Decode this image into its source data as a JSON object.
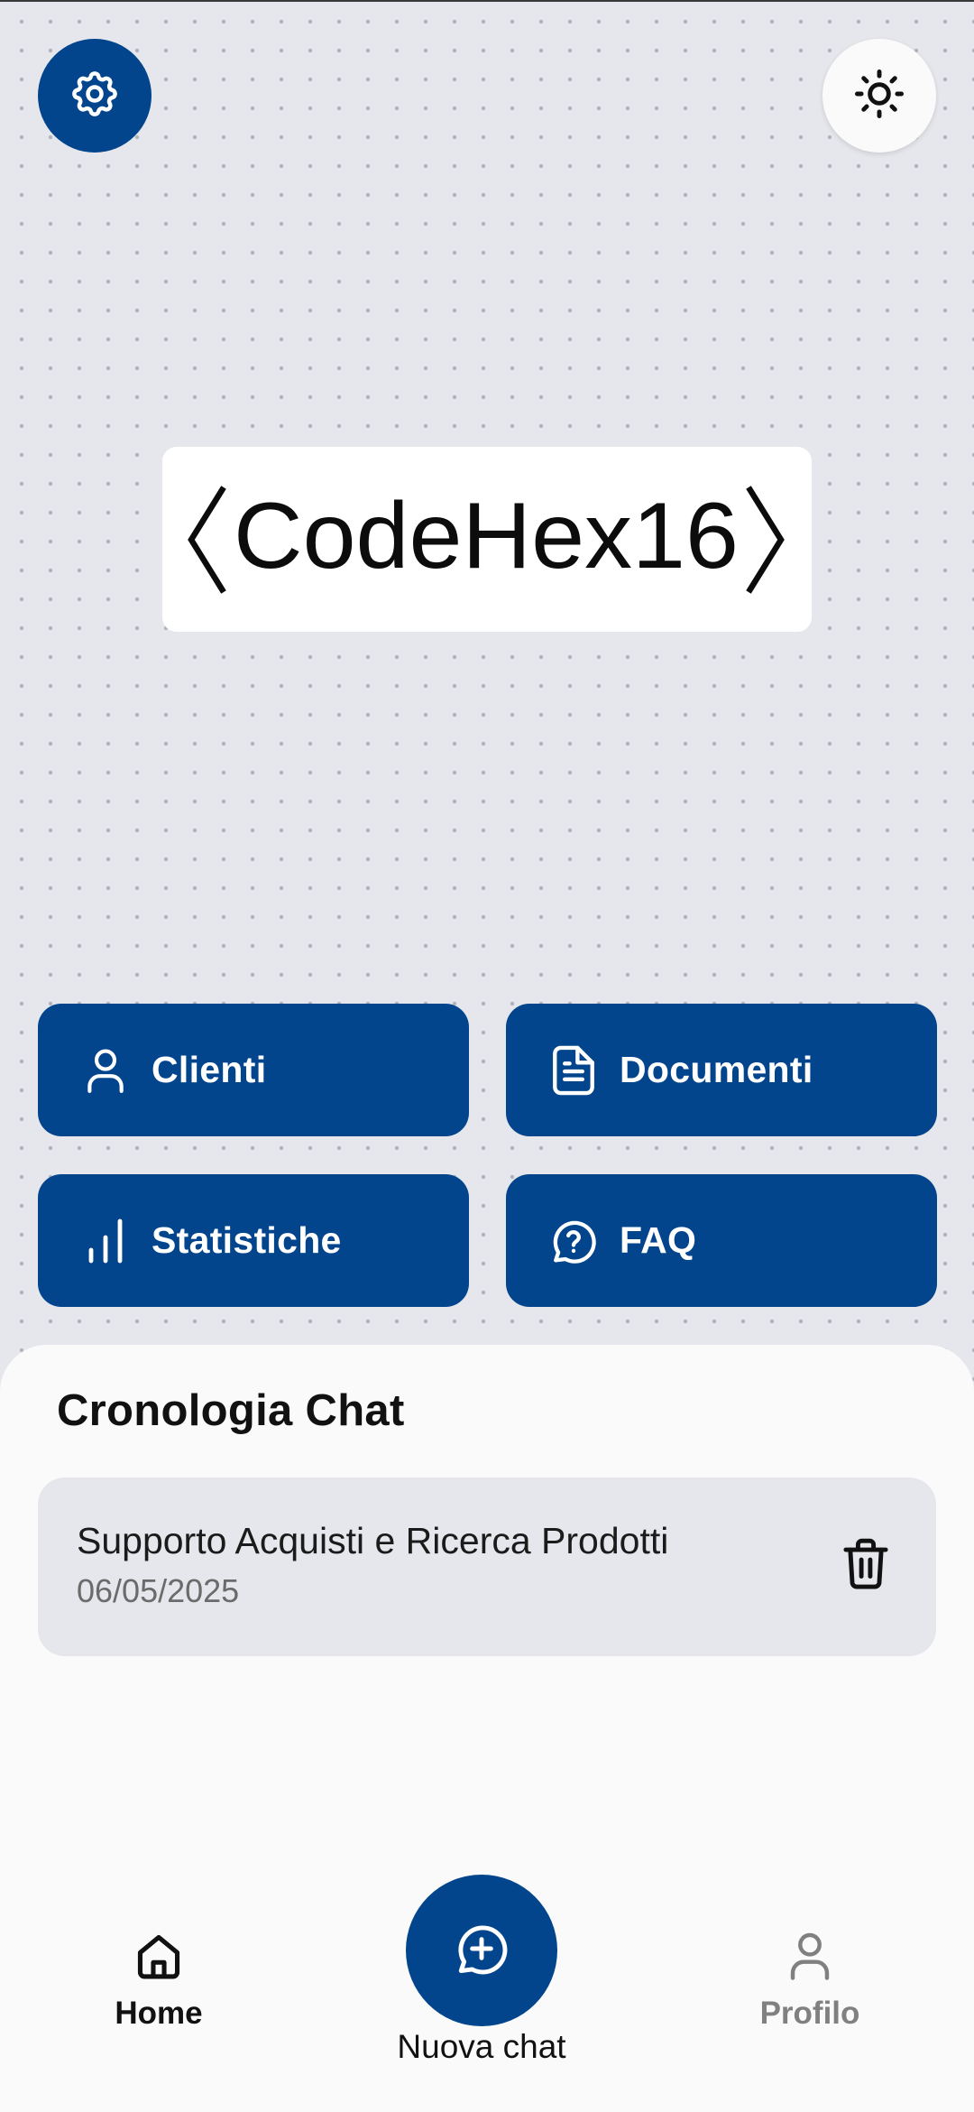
{
  "header": {
    "settings_icon": "gear-icon",
    "theme_icon": "sun-icon"
  },
  "logo": {
    "text": "CodeHex16"
  },
  "actions": [
    {
      "label": "Clienti",
      "icon": "user-icon"
    },
    {
      "label": "Documenti",
      "icon": "document-icon"
    },
    {
      "label": "Statistiche",
      "icon": "bar-chart-icon"
    },
    {
      "label": "FAQ",
      "icon": "question-bubble-icon"
    }
  ],
  "history": {
    "title": "Cronologia Chat",
    "items": [
      {
        "title": "Supporto Acquisti e Ricerca Prodotti",
        "date": "06/05/2025"
      }
    ]
  },
  "bottom_nav": {
    "home_label": "Home",
    "new_chat_label": "Nuova chat",
    "profile_label": "Profilo"
  },
  "colors": {
    "primary": "#02458d",
    "background": "#e6e7ec",
    "sheet": "#fafafa"
  }
}
